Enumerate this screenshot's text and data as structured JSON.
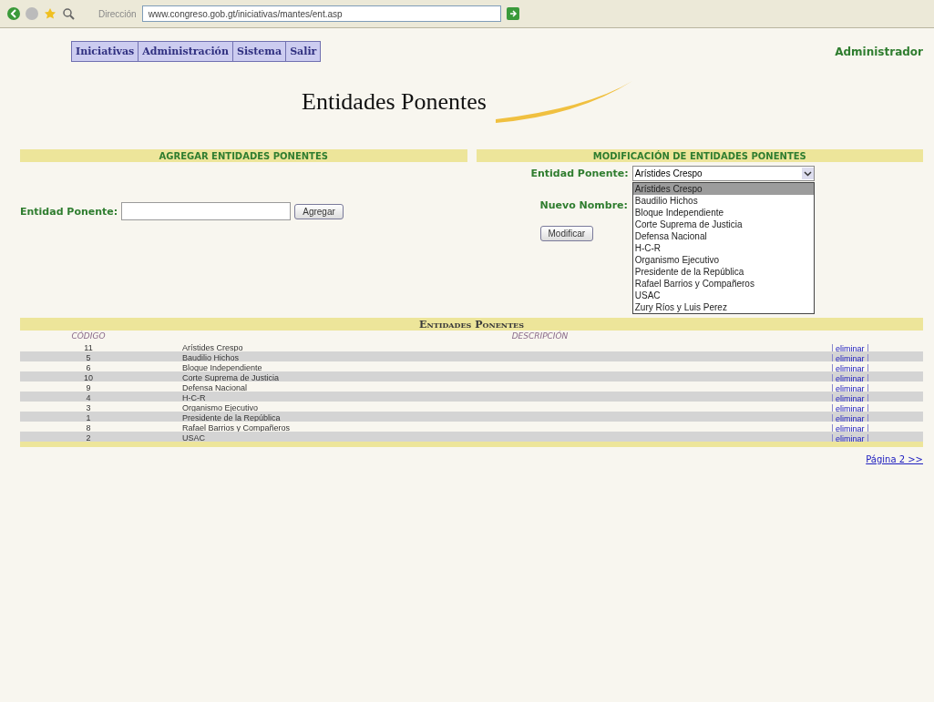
{
  "browser": {
    "address_label": "Dirección",
    "address": "www.congreso.gob.gt/iniciativas/mantes/ent.asp"
  },
  "menu": [
    {
      "label": "Iniciativas"
    },
    {
      "label": "Administración"
    },
    {
      "label": "Sistema"
    },
    {
      "label": "Salir"
    }
  ],
  "user": "Administrador",
  "title": "Entidades Ponentes",
  "add_section": {
    "heading": "AGREGAR ENTIDADES PONENTES",
    "label": "Entidad Ponente:",
    "button": "Agregar"
  },
  "modify_section": {
    "heading": "MODIFICACIÓN DE ENTIDADES PONENTES",
    "entity_label": "Entidad Ponente:",
    "select_value": "Arístides Crespo",
    "new_name_label": "Nuevo Nombre:",
    "button": "Modificar",
    "dropdown_open": true,
    "options": [
      {
        "label": "Arístides Crespo",
        "selected": true
      },
      {
        "label": "Baudilio Hichos",
        "selected": false
      },
      {
        "label": "Bloque Independiente",
        "selected": false
      },
      {
        "label": "Corte Suprema de Justicia",
        "selected": false
      },
      {
        "label": "Defensa Nacional",
        "selected": false
      },
      {
        "label": "H-C-R",
        "selected": false
      },
      {
        "label": "Organismo Ejecutivo",
        "selected": false
      },
      {
        "label": "Presidente de la República",
        "selected": false
      },
      {
        "label": "Rafael Barrios y Compañeros",
        "selected": false
      },
      {
        "label": "USAC",
        "selected": false
      },
      {
        "label": "Zury Ríos y Luis Perez",
        "selected": false
      }
    ]
  },
  "table": {
    "title": "Entidades Ponentes",
    "columns": [
      "CÓDIGO",
      "DESCRIPCIÓN"
    ],
    "rows": [
      {
        "code": "11",
        "description": "Arístides Crespo",
        "action": "eliminar"
      },
      {
        "code": "5",
        "description": "Baudilio Hichos",
        "action": "eliminar"
      },
      {
        "code": "6",
        "description": "Bloque Independiente",
        "action": "eliminar"
      },
      {
        "code": "10",
        "description": "Corte Suprema de Justicia",
        "action": "eliminar"
      },
      {
        "code": "9",
        "description": "Defensa Nacional",
        "action": "eliminar"
      },
      {
        "code": "4",
        "description": "H-C-R",
        "action": "eliminar"
      },
      {
        "code": "3",
        "description": "Organismo Ejecutivo",
        "action": "eliminar"
      },
      {
        "code": "1",
        "description": "Presidente de la República",
        "action": "eliminar"
      },
      {
        "code": "8",
        "description": "Rafael Barrios y Compañeros",
        "action": "eliminar"
      },
      {
        "code": "2",
        "description": "USAC",
        "action": "eliminar"
      }
    ]
  },
  "pager": "Página 2 >>"
}
